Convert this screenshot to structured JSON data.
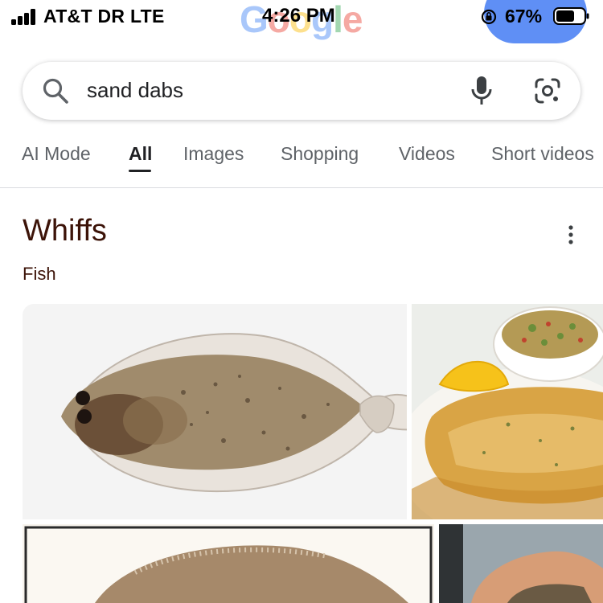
{
  "status_bar": {
    "carrier": "AT&T DR  LTE",
    "time": "4:26 PM",
    "battery": "67%",
    "logo_letters": [
      "G",
      "o",
      "o",
      "g",
      "l",
      "e"
    ]
  },
  "search": {
    "query": "sand dabs",
    "icons": [
      "search-icon",
      "mic-icon",
      "lens-icon"
    ]
  },
  "tabs": [
    {
      "label": "AI Mode",
      "active": false
    },
    {
      "label": "All",
      "active": true
    },
    {
      "label": "Images",
      "active": false
    },
    {
      "label": "Shopping",
      "active": false
    },
    {
      "label": "Videos",
      "active": false
    },
    {
      "label": "Short videos",
      "active": false
    }
  ],
  "knowledge_panel": {
    "title": "Whiffs",
    "subtitle": "Fish"
  },
  "colors": {
    "title_brown": "#3c1308",
    "tab_inactive": "#5f6368",
    "google_blue": "#4285f4",
    "profile_chip": "#5f8ff5"
  }
}
